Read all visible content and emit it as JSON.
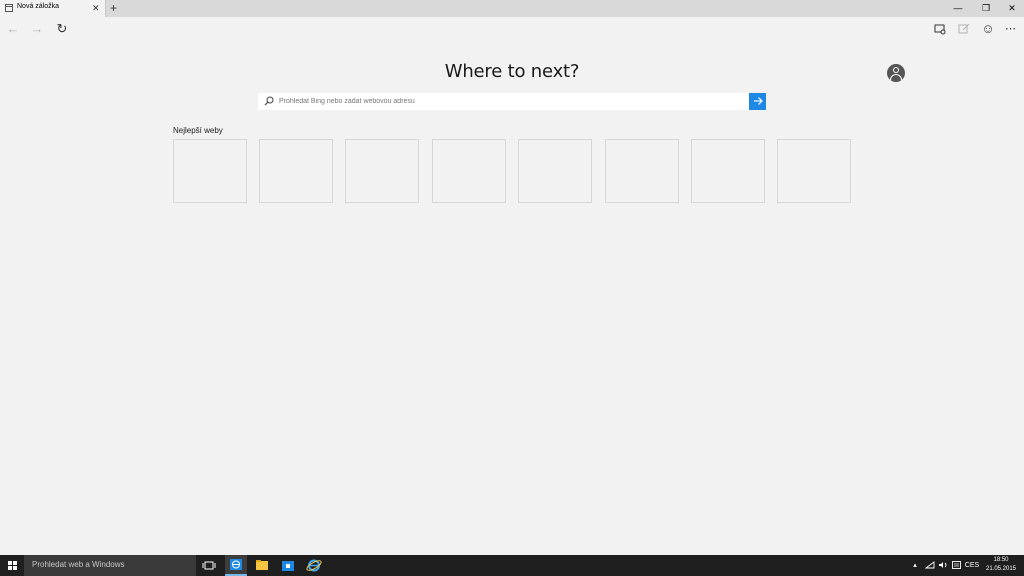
{
  "browser": {
    "tab": {
      "title": "Nová záložka"
    },
    "window_controls": {
      "minimize": "—",
      "restore": "❐",
      "close": "✕"
    }
  },
  "main": {
    "headline": "Where to next?",
    "search": {
      "placeholder": "Prohledat Bing nebo zadat webovou adresu",
      "value": ""
    },
    "top_sites": {
      "title": "Nejlepší weby",
      "tile_count": 8
    }
  },
  "taskbar": {
    "search_text": "Prohledat web a Windows",
    "language": "CES",
    "time": "18:50",
    "date": "21.05.2015"
  },
  "colors": {
    "accent": "#1e88e5",
    "taskbar": "#1f1f1f",
    "page_bg": "#f2f2f2"
  }
}
